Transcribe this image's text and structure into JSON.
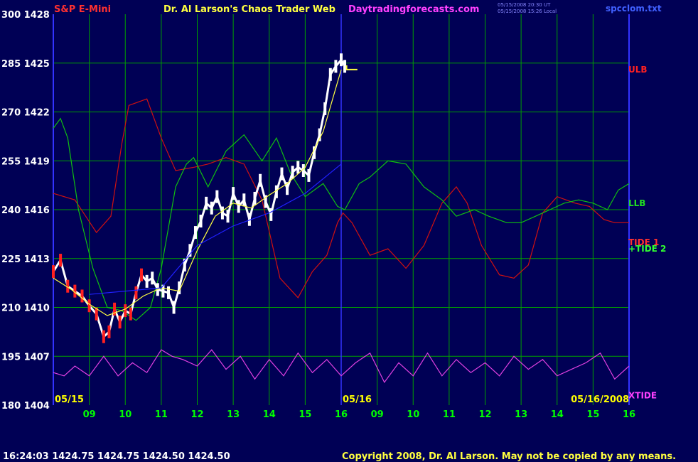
{
  "header": {
    "instrument": "S&P E-Mini",
    "site": "Dr. Al Larson's Chaos Trader Web",
    "url": "Daytradingforecasts.com",
    "meta_line1": "05/15/2008 20:30 UT",
    "meta_line2": "05/15/2008 15:26 Local",
    "file": "spcclom.txt"
  },
  "footer": {
    "quote": "16:24:03  1424.75  1424.75  1424.50  1424.50",
    "copyright": "Copyright 2008, Dr. Al Larson. May not be copied by any means."
  },
  "colors": {
    "background": "#000055",
    "grid": "#00a000",
    "axis": "#3333ff",
    "price_down": "#ff2020",
    "price_up": "#ffffff",
    "ulb": "#d01010",
    "llb": "#10c010",
    "xtide": "#e040e0",
    "avg": "#ffff40",
    "trend": "#2020ff"
  },
  "chart_data": {
    "type": "line",
    "title": "S&P E-Mini",
    "y_left_ticks": [
      "300",
      "285",
      "270",
      "255",
      "240",
      "225",
      "210",
      "195",
      "180"
    ],
    "y_right_ticks": [
      "1428",
      "1425",
      "1422",
      "1419",
      "1416",
      "1413",
      "1410",
      "1407",
      "1404"
    ],
    "ylim_left": [
      180,
      300
    ],
    "ylim_price": [
      1404,
      1428
    ],
    "x_tick_labels": [
      "09",
      "10",
      "11",
      "12",
      "13",
      "14",
      "15",
      "16",
      "09",
      "10",
      "11",
      "12",
      "13",
      "14",
      "15",
      "16"
    ],
    "date_labels": [
      {
        "text": "05/15",
        "x": 8.0
      },
      {
        "text": "05/16",
        "x": 16.0
      },
      {
        "text": "05/16/2008",
        "x": 24.0
      }
    ],
    "xlim": [
      8.0,
      24.0
    ],
    "grid": true,
    "series": [
      {
        "name": "ULB",
        "x": [
          8.0,
          8.6,
          9.2,
          9.6,
          9.9,
          10.1,
          10.6,
          11.0,
          11.4,
          11.9,
          12.3,
          12.8,
          13.3,
          13.8,
          14.3,
          14.8,
          15.2,
          15.6,
          15.9,
          16.05,
          16.3,
          16.8,
          17.3,
          17.8,
          18.3,
          18.8,
          19.2,
          19.5,
          19.9,
          20.4,
          20.8,
          21.2,
          21.6,
          22.0,
          22.5,
          22.9,
          23.3,
          23.6,
          24.0
        ],
        "y": [
          245,
          243,
          233,
          238,
          260,
          272,
          274,
          262,
          252,
          253,
          254,
          256,
          254,
          243,
          219,
          213,
          221,
          226,
          236,
          239,
          236,
          226,
          228,
          222,
          229,
          242,
          247,
          242,
          229,
          220,
          219,
          223,
          239,
          244,
          242,
          241,
          237,
          236,
          236
        ]
      },
      {
        "name": "LLB",
        "x": [
          8.0,
          8.2,
          8.4,
          8.7,
          9.1,
          9.5,
          9.9,
          10.3,
          10.7,
          11.0,
          11.4,
          11.7,
          11.9,
          12.3,
          12.8,
          13.3,
          13.8,
          14.2,
          14.6,
          15.0,
          15.5,
          15.9,
          16.1,
          16.5,
          16.8,
          17.3,
          17.8,
          18.3,
          18.8,
          19.2,
          19.7,
          20.1,
          20.6,
          21.0,
          21.4,
          21.8,
          22.2,
          22.6,
          23.0,
          23.4,
          23.7,
          24.0
        ],
        "y": [
          265,
          268,
          262,
          240,
          222,
          210,
          209,
          206,
          210,
          222,
          247,
          254,
          256,
          247,
          258,
          263,
          255,
          262,
          251,
          244,
          248,
          241,
          240,
          248,
          250,
          255,
          254,
          247,
          243,
          238,
          240,
          238,
          236,
          236,
          238,
          240,
          242,
          243,
          242,
          240,
          246,
          248
        ]
      },
      {
        "name": "XTIDE",
        "x": [
          8.0,
          8.3,
          8.6,
          9.0,
          9.4,
          9.8,
          10.2,
          10.6,
          11.0,
          11.3,
          11.6,
          12.0,
          12.4,
          12.8,
          13.2,
          13.6,
          14.0,
          14.4,
          14.8,
          15.2,
          15.6,
          16.0,
          16.4,
          16.8,
          17.2,
          17.6,
          18.0,
          18.4,
          18.8,
          19.2,
          19.6,
          20.0,
          20.4,
          20.8,
          21.2,
          21.6,
          22.0,
          22.4,
          22.8,
          23.2,
          23.6,
          24.0
        ],
        "y": [
          190,
          189,
          192,
          189,
          195,
          189,
          193,
          190,
          197,
          195,
          194,
          192,
          197,
          191,
          195,
          188,
          194,
          189,
          196,
          190,
          194,
          189,
          193,
          196,
          187,
          193,
          189,
          196,
          189,
          194,
          190,
          193,
          189,
          195,
          191,
          194,
          189,
          191,
          193,
          196,
          188,
          192
        ]
      },
      {
        "name": "TIDE 1",
        "x": [
          8.0,
          8.5,
          9.0,
          9.5,
          10.0,
          10.5,
          11.0,
          11.5,
          12.0,
          12.5,
          13.0,
          13.5,
          14.0,
          14.5,
          15.0,
          15.5,
          16.0,
          16.5,
          17.0,
          17.5,
          18.0,
          18.5,
          19.0,
          19.5,
          20.0,
          20.5,
          21.0,
          21.5,
          22.0,
          22.5,
          23.0,
          23.5,
          24.0
        ],
        "y": [
          236,
          240,
          245,
          242,
          238,
          233,
          236,
          240,
          245,
          244,
          242,
          238,
          235,
          236,
          240,
          242,
          244,
          239,
          233,
          232,
          236,
          240,
          243,
          240,
          234,
          231,
          233,
          239,
          244,
          241,
          236,
          235,
          236
        ]
      },
      {
        "name": "TIDE 2",
        "x": [
          8.0,
          8.5,
          9.0,
          9.5,
          10.0,
          10.5,
          11.0,
          11.5,
          12.0,
          12.5,
          13.0,
          13.5,
          14.0,
          14.5,
          15.0,
          15.5,
          16.0,
          16.5,
          17.0,
          17.5,
          18.0,
          18.5,
          19.0,
          19.5,
          20.0,
          20.5,
          21.0,
          21.5,
          22.0,
          22.5,
          23.0,
          23.5,
          24.0
        ],
        "y": [
          234,
          232,
          236,
          241,
          243,
          240,
          235,
          232,
          234,
          238,
          242,
          243,
          240,
          236,
          233,
          235,
          239,
          242,
          240,
          236,
          233,
          234,
          238,
          241,
          240,
          237,
          234,
          235,
          238,
          240,
          238,
          235,
          234
        ]
      },
      {
        "name": "price",
        "x": [
          8.0,
          8.2,
          8.4,
          8.6,
          8.8,
          9.0,
          9.2,
          9.4,
          9.55,
          9.7,
          9.85,
          10.0,
          10.15,
          10.3,
          10.45,
          10.6,
          10.75,
          10.9,
          11.05,
          11.2,
          11.35,
          11.5,
          11.65,
          11.8,
          11.95,
          12.1,
          12.25,
          12.4,
          12.55,
          12.7,
          12.85,
          13.0,
          13.15,
          13.3,
          13.45,
          13.6,
          13.75,
          13.9,
          14.05,
          14.2,
          14.35,
          14.5,
          14.65,
          14.8,
          14.95,
          15.1,
          15.25,
          15.4,
          15.55,
          15.7,
          15.85,
          16.0,
          16.1
        ],
        "y": [
          1412.2,
          1412.9,
          1411.3,
          1411.0,
          1410.7,
          1410.1,
          1409.6,
          1408.2,
          1408.5,
          1409.9,
          1409.1,
          1409.8,
          1409.6,
          1410.9,
          1412.0,
          1411.6,
          1411.8,
          1411.1,
          1411.0,
          1410.9,
          1410.0,
          1411.2,
          1412.6,
          1413.5,
          1414.6,
          1415.3,
          1416.4,
          1416.1,
          1416.8,
          1415.8,
          1415.6,
          1417.0,
          1416.2,
          1416.6,
          1415.4,
          1416.7,
          1417.8,
          1416.5,
          1415.7,
          1417.1,
          1418.2,
          1417.3,
          1418.3,
          1418.6,
          1418.4,
          1418.1,
          1419.5,
          1420.6,
          1422.2,
          1424.3,
          1424.8,
          1425.2,
          1424.8
        ]
      },
      {
        "name": "avg",
        "x": [
          8.0,
          8.5,
          9.0,
          9.5,
          10.0,
          10.5,
          11.0,
          11.5,
          12.0,
          12.5,
          13.0,
          13.5,
          14.0,
          14.5,
          15.0,
          15.5,
          16.0
        ],
        "y": [
          1411.8,
          1411.1,
          1410.2,
          1409.5,
          1409.9,
          1410.7,
          1411.2,
          1411.0,
          1413.5,
          1415.6,
          1416.4,
          1416.1,
          1416.9,
          1417.6,
          1418.6,
          1420.8,
          1424.6
        ]
      },
      {
        "name": "trend",
        "x": [
          9.0,
          11.0,
          12.0,
          13.0,
          14.0,
          15.0,
          16.0
        ],
        "y": [
          1410.8,
          1411.2,
          1413.8,
          1415.0,
          1415.8,
          1417.0,
          1418.8
        ]
      }
    ],
    "series_labels": [
      {
        "text": "ULB",
        "color": "#ff2020",
        "y_left": 283
      },
      {
        "text": "LLB",
        "color": "#20e020",
        "y_left": 242
      },
      {
        "text": "TIDE 1",
        "color": "#ff3030",
        "y_left": 230
      },
      {
        "text": "+TIDE 2",
        "color": "#30ff30",
        "y_left": 228
      },
      {
        "text": "XTIDE",
        "color": "#ff40ff",
        "y_left": 183
      }
    ],
    "projection": {
      "x": [
        16.15,
        16.45
      ],
      "price": 1424.6
    }
  }
}
